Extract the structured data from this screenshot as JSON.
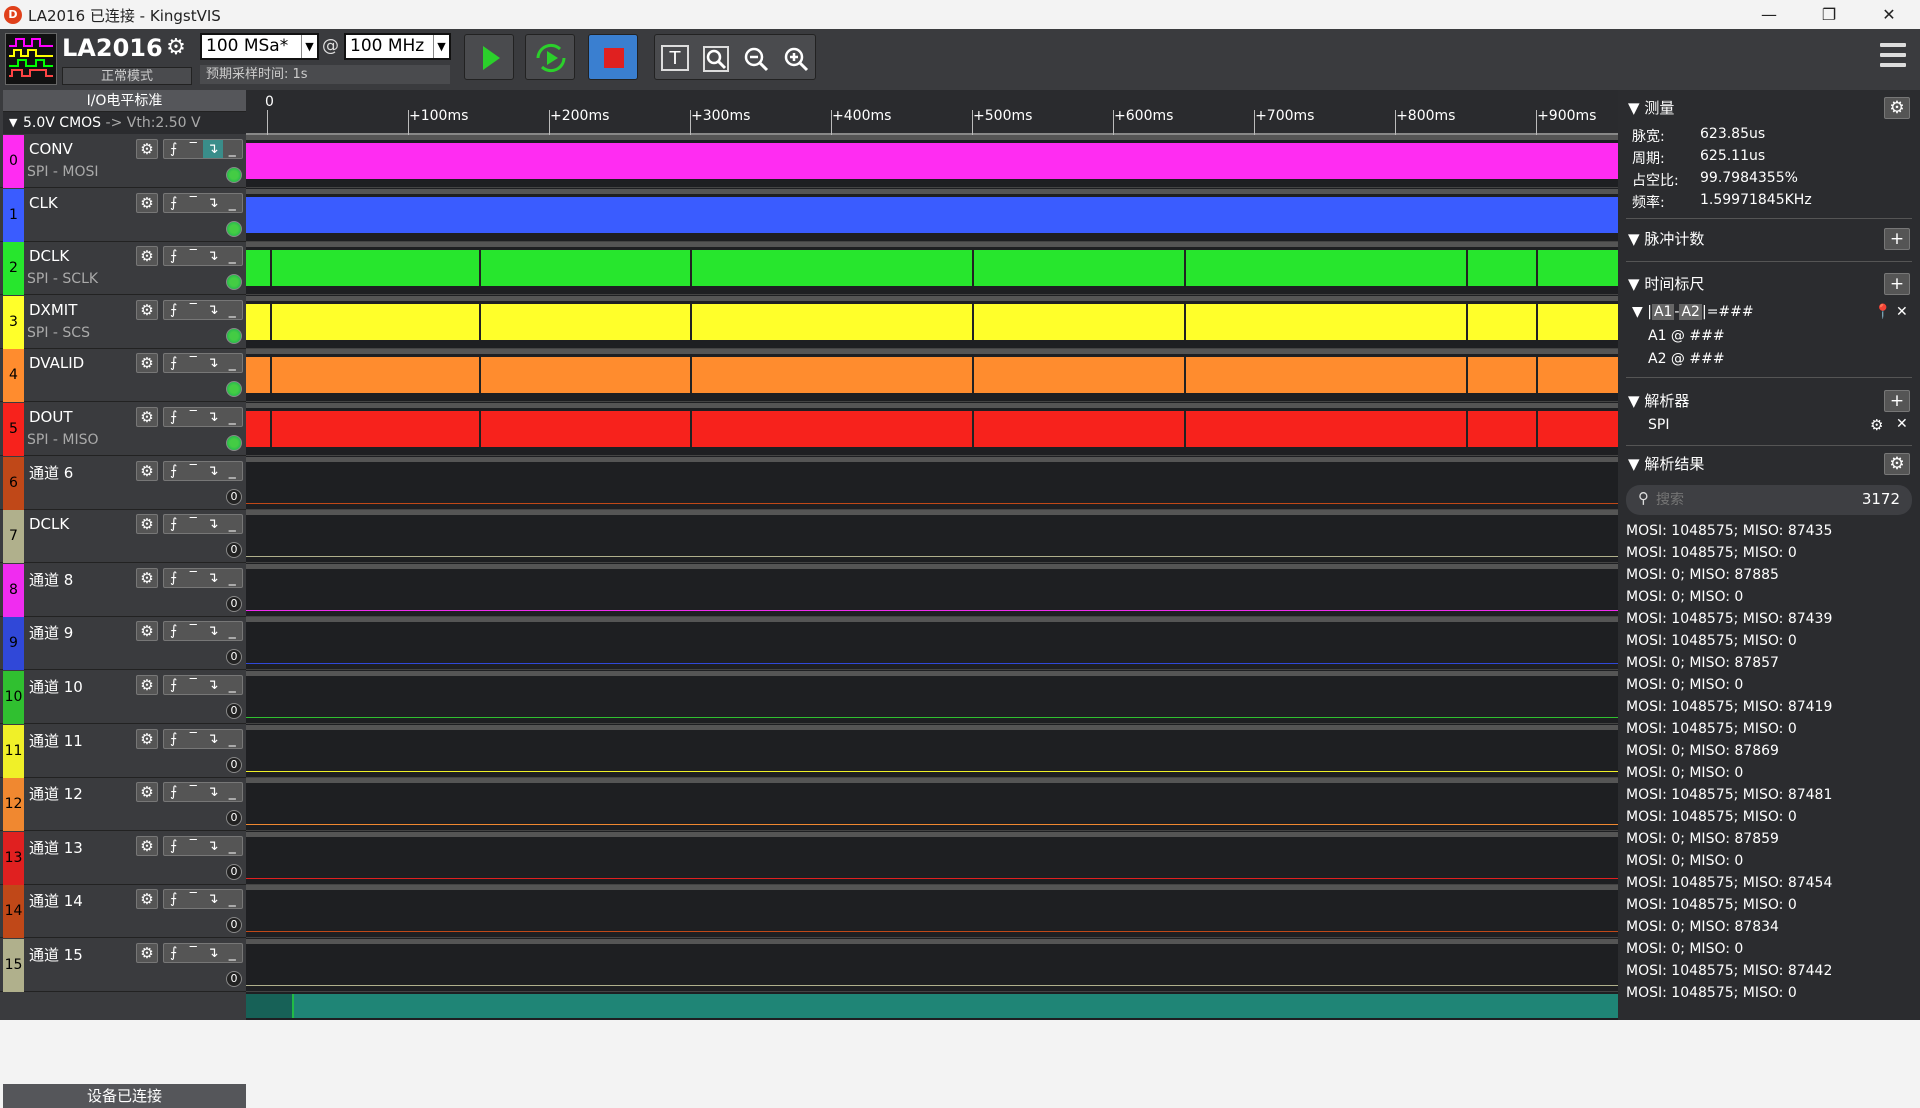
{
  "window": {
    "title": "LA2016 已连接 - KingstVIS",
    "icon_label": "D",
    "minimize": "—",
    "maximize": "❐",
    "close": "✕"
  },
  "toolbar": {
    "device": "LA2016",
    "mode": "正常模式",
    "sample_rate": "100 MSa*",
    "at": "@",
    "threshold_freq": "100 MHz",
    "est_time": "预期采样时间: 1s"
  },
  "io": {
    "header": "I/O电平标准",
    "value": "5.0V CMOS",
    "vth": "-> Vth:2.50 V"
  },
  "channels": [
    {
      "num": "0",
      "name": "CONV",
      "sub": "SPI - MOSI",
      "color": "#ff2cf2",
      "led": "on",
      "active_trig": 3,
      "wave": "high"
    },
    {
      "num": "1",
      "name": "CLK",
      "sub": "",
      "color": "#3a5cff",
      "led": "on",
      "active_trig": 0,
      "wave": "high"
    },
    {
      "num": "2",
      "name": "DCLK",
      "sub": "SPI - SCLK",
      "color": "#27e62d",
      "led": "on",
      "active_trig": 0,
      "wave": "pulses"
    },
    {
      "num": "3",
      "name": "DXMIT",
      "sub": "SPI - SCS",
      "color": "#ffff2a",
      "led": "on",
      "active_trig": 0,
      "wave": "pulses"
    },
    {
      "num": "4",
      "name": "DVALID",
      "sub": "",
      "color": "#ff8c2e",
      "led": "on",
      "active_trig": 0,
      "wave": "pulses"
    },
    {
      "num": "5",
      "name": "DOUT",
      "sub": "SPI - MISO",
      "color": "#f7221c",
      "led": "on",
      "active_trig": 0,
      "wave": "pulses"
    },
    {
      "num": "6",
      "name": "通道 6",
      "sub": "",
      "color": "#c04818",
      "led": "0",
      "active_trig": 0,
      "wave": "low"
    },
    {
      "num": "7",
      "name": "DCLK",
      "sub": "",
      "color": "#b0b08c",
      "led": "0",
      "active_trig": 0,
      "wave": "low"
    },
    {
      "num": "8",
      "name": "通道 8",
      "sub": "",
      "color": "#f02cf0",
      "led": "0",
      "active_trig": 0,
      "wave": "low"
    },
    {
      "num": "9",
      "name": "通道 9",
      "sub": "",
      "color": "#3048d8",
      "led": "0",
      "active_trig": 0,
      "wave": "low"
    },
    {
      "num": "10",
      "name": "通道 10",
      "sub": "",
      "color": "#30c030",
      "led": "0",
      "active_trig": 0,
      "wave": "low"
    },
    {
      "num": "11",
      "name": "通道 11",
      "sub": "",
      "color": "#f0f028",
      "led": "0",
      "active_trig": 0,
      "wave": "low"
    },
    {
      "num": "12",
      "name": "通道 12",
      "sub": "",
      "color": "#f08830",
      "led": "0",
      "active_trig": 0,
      "wave": "low"
    },
    {
      "num": "13",
      "name": "通道 13",
      "sub": "",
      "color": "#e02020",
      "led": "0",
      "active_trig": 0,
      "wave": "low"
    },
    {
      "num": "14",
      "name": "通道 14",
      "sub": "",
      "color": "#c04818",
      "led": "0",
      "active_trig": 0,
      "wave": "low"
    },
    {
      "num": "15",
      "name": "通道 15",
      "sub": "",
      "color": "#b0b08c",
      "led": "0",
      "active_trig": 0,
      "wave": "low"
    }
  ],
  "ruler": {
    "labels": [
      "0",
      "+100ms",
      "+200ms",
      "+300ms",
      "+400ms",
      "+500ms",
      "+600ms",
      "+700ms",
      "+800ms",
      "+900ms"
    ]
  },
  "edges_ms": [
    2,
    150,
    300,
    500,
    650,
    850,
    900
  ],
  "status": "设备已连接",
  "measure": {
    "title": "测量",
    "rows": [
      {
        "k": "脉宽:",
        "v": "623.85us"
      },
      {
        "k": "周期:",
        "v": "625.11us"
      },
      {
        "k": "占空比:",
        "v": "99.7984355%"
      },
      {
        "k": "频率:",
        "v": "1.59971845KHz"
      }
    ]
  },
  "pulse": {
    "title": "脉冲计数"
  },
  "timemark": {
    "title": "时间标尺",
    "formula_a": "A1",
    "formula_b": "A2",
    "formula_suffix": "=###",
    "a1": "A1 @ ###",
    "a2": "A2 @ ###"
  },
  "analyzer": {
    "title": "解析器",
    "item": "SPI"
  },
  "results": {
    "title": "解析结果",
    "search_placeholder": "搜索",
    "count": "3172",
    "rows": [
      "MOSI: 1048575;  MISO: 87435",
      "MOSI: 1048575;  MISO: 0",
      "MOSI: 0;  MISO: 87885",
      "MOSI: 0;  MISO: 0",
      "MOSI: 1048575;  MISO: 87439",
      "MOSI: 1048575;  MISO: 0",
      "MOSI: 0;  MISO: 87857",
      "MOSI: 0;  MISO: 0",
      "MOSI: 1048575;  MISO: 87419",
      "MOSI: 1048575;  MISO: 0",
      "MOSI: 0;  MISO: 87869",
      "MOSI: 0;  MISO: 0",
      "MOSI: 1048575;  MISO: 87481",
      "MOSI: 1048575;  MISO: 0",
      "MOSI: 0;  MISO: 87859",
      "MOSI: 0;  MISO: 0",
      "MOSI: 1048575;  MISO: 87454",
      "MOSI: 1048575;  MISO: 0",
      "MOSI: 0;  MISO: 87834",
      "MOSI: 0;  MISO: 0",
      "MOSI: 1048575;  MISO: 87442",
      "MOSI: 1048575;  MISO: 0"
    ]
  }
}
